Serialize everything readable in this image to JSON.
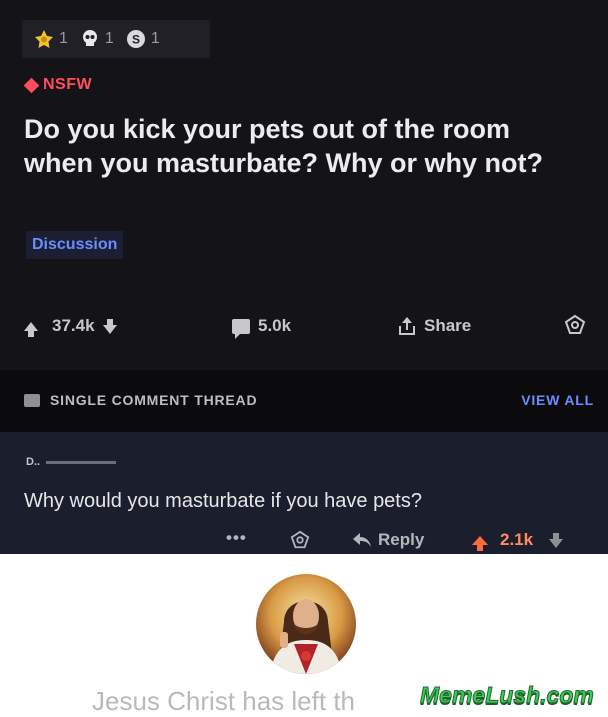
{
  "post": {
    "awards": [
      {
        "icon": "medal-award-icon",
        "count": "1"
      },
      {
        "icon": "skull-award-icon",
        "count": "1"
      },
      {
        "icon": "coin-award-icon",
        "count": "1"
      }
    ],
    "nsfw_label": "NSFW",
    "title": "Do you kick your pets out of the room when you masturbate? Why or why not?",
    "flair": "Discussion",
    "votes": "37.4k",
    "comments": "5.0k",
    "share_label": "Share",
    "colors": {
      "background": "#141418",
      "nsfw": "#ff4d5c",
      "flair_text": "#6b8cff"
    }
  },
  "thread_bar": {
    "label": "SINGLE COMMENT THREAD",
    "view_all": "VIEW ALL"
  },
  "comment": {
    "author": "D..",
    "text": "Why would you masturbate if you have pets?",
    "more": "•••",
    "reply_label": "Reply",
    "score": "2.1k",
    "colors": {
      "background": "#1b1f2d",
      "upvote": "#ff6b3d"
    }
  },
  "footer": {
    "left_text": "Jesus Christ has left th",
    "watermark": "MemeLush.com"
  }
}
